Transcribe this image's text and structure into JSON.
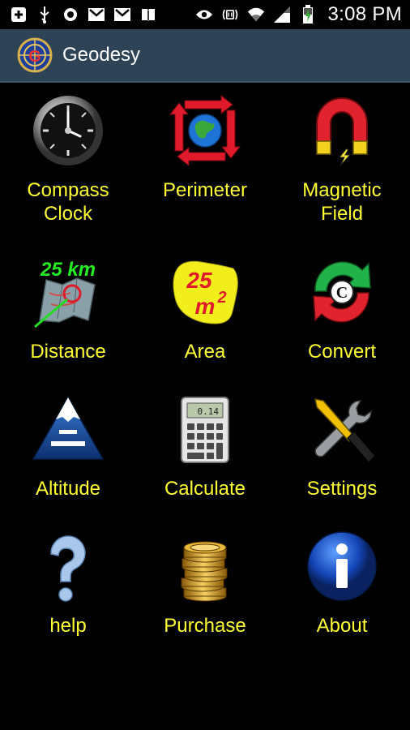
{
  "status_bar": {
    "left_icons": [
      "add-icon",
      "usb-icon",
      "record-icon",
      "gmail-icon",
      "gmail-icon",
      "book-icon"
    ],
    "right_icons": [
      "eye-icon",
      "nfc-icon",
      "wifi-icon",
      "signal-icon",
      "battery-charging-icon"
    ],
    "time": "3:08 PM"
  },
  "app": {
    "title": "Geodesy",
    "logo_icon": "geodesy-globe-icon"
  },
  "colors": {
    "label": "#ffff33",
    "titlebar": "#2f4356",
    "background": "#000000"
  },
  "menu": {
    "items": [
      {
        "label": "Compass\nClock",
        "icon": "compass-clock-icon"
      },
      {
        "label": "Perimeter",
        "icon": "perimeter-icon"
      },
      {
        "label": "Magnetic\nField",
        "icon": "magnet-icon"
      },
      {
        "label": "Distance",
        "icon": "distance-map-icon",
        "badge": "25 km"
      },
      {
        "label": "Area",
        "icon": "area-blob-icon",
        "badge": "25",
        "badge_unit": "m",
        "badge_exp": "2"
      },
      {
        "label": "Convert",
        "icon": "convert-arrows-icon",
        "badge": "C"
      },
      {
        "label": "Altitude",
        "icon": "mountain-icon"
      },
      {
        "label": "Calculate",
        "icon": "calculator-icon",
        "badge": "0.14"
      },
      {
        "label": "Settings",
        "icon": "tools-icon"
      },
      {
        "label": "help",
        "icon": "question-mark-icon"
      },
      {
        "label": "Purchase",
        "icon": "gold-coins-icon"
      },
      {
        "label": "About",
        "icon": "info-icon"
      }
    ]
  }
}
